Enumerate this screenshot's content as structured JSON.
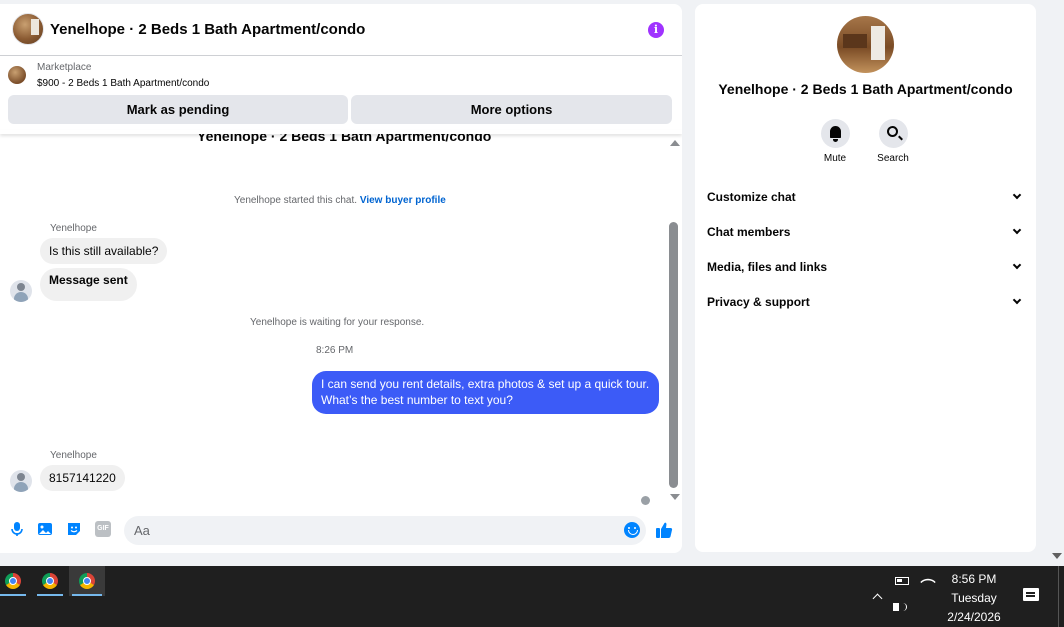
{
  "chat": {
    "title": "Yenelhope · 2 Beds 1 Bath Apartment/condo",
    "listing_source": "Marketplace",
    "listing_price_title": "$900 - 2 Beds 1 Bath Apartment/condo",
    "mark_pending_label": "Mark as pending",
    "more_options_label": "More options",
    "cut_off_title": "Yenelhope · 2 Beds 1 Bath Apartment/condo",
    "started_text": "Yenelhope started this chat.",
    "view_profile_link": "View buyer profile",
    "sender_name": "Yenelhope",
    "msg_available": "Is this still available?",
    "msg_sent": "Message sent",
    "waiting_text": "Yenelhope is waiting for your response.",
    "timestamp": "8:26 PM",
    "outgoing_message": "I can send you rent details, extra photos & set up a quick tour. What’s the best number to text you?",
    "sender_name_2": "Yenelhope",
    "msg_number": "8157141220",
    "composer_placeholder": "Aa",
    "gif_label": "GIF",
    "info_icon_glyph": "i",
    "accent_color": "#3c5bf7"
  },
  "details": {
    "title": "Yenelhope · 2 Beds 1 Bath Apartment/condo",
    "mute_label": "Mute",
    "search_label": "Search",
    "sections": [
      "Customize chat",
      "Chat members",
      "Media, files and links",
      "Privacy & support"
    ]
  },
  "taskbar": {
    "time": "8:56 PM",
    "day": "Tuesday",
    "date": "2/24/2026",
    "apps": [
      "chrome-icon",
      "chrome-icon",
      "chrome-icon"
    ]
  }
}
